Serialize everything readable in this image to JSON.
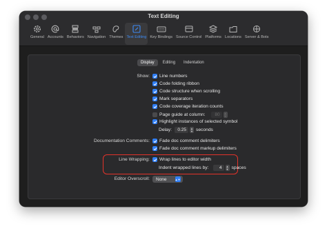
{
  "window": {
    "title": "Text Editing"
  },
  "toolbar": {
    "items": [
      {
        "label": "General",
        "icon": "gear-icon"
      },
      {
        "label": "Accounts",
        "icon": "at-icon"
      },
      {
        "label": "Behaviors",
        "icon": "behaviors-icon"
      },
      {
        "label": "Navigation",
        "icon": "navigation-icon"
      },
      {
        "label": "Themes",
        "icon": "themes-icon"
      },
      {
        "label": "Text Editing",
        "icon": "text-editing-icon",
        "active": true
      },
      {
        "label": "Key Bindings",
        "icon": "keyboard-icon"
      },
      {
        "label": "Source Control",
        "icon": "source-control-icon"
      },
      {
        "label": "Platforms",
        "icon": "platforms-icon"
      },
      {
        "label": "Locations",
        "icon": "locations-icon"
      },
      {
        "label": "Server & Bots",
        "icon": "server-icon"
      }
    ]
  },
  "tabs": {
    "display": "Display",
    "editing": "Editing",
    "indentation": "Indentation"
  },
  "show": {
    "label": "Show:",
    "line_numbers": "Line numbers",
    "code_folding": "Code folding ribbon",
    "code_structure": "Code structure when scrolling",
    "mark_separators": "Mark separators",
    "code_coverage": "Code coverage iteration counts",
    "page_guide": "Page guide at column:",
    "page_guide_value": "80",
    "highlight_instances": "Highlight instances of selected symbol",
    "delay_label": "Delay:",
    "delay_value": "0.25",
    "delay_unit": "seconds"
  },
  "doc_comments": {
    "label": "Documentation Comments:",
    "fade_delimiters": "Fade doc comment delimiters",
    "fade_markup": "Fade doc comment markup delimiters"
  },
  "wrapping": {
    "label": "Line Wrapping:",
    "wrap_lines": "Wrap lines to editor width",
    "indent_label": "Indent wrapped lines by:",
    "indent_value": "4",
    "indent_unit": "spaces"
  },
  "overscroll": {
    "label": "Editor Overscroll:",
    "value": "None"
  },
  "colors": {
    "accent": "#2f7ef6",
    "highlight": "#e5332a",
    "background": "#1e1e1e"
  }
}
